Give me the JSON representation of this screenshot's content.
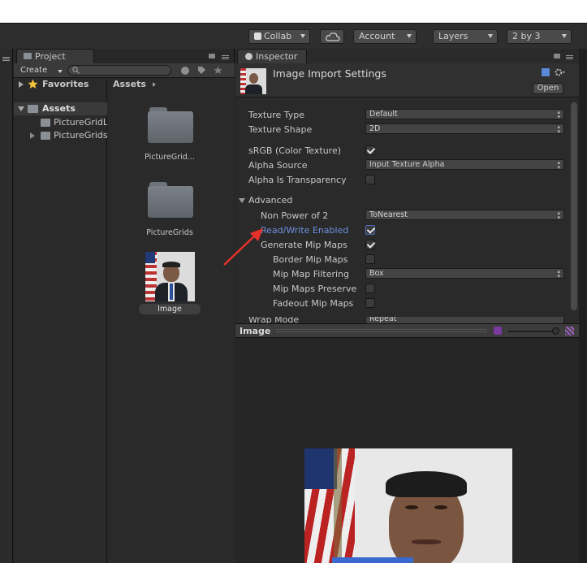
{
  "toolbar": {
    "collab": "Collab",
    "account": "Account",
    "layers": "Layers",
    "layout": "2 by 3"
  },
  "project": {
    "tab": "Project",
    "create": "Create",
    "search_placeholder": "",
    "favorites": "Favorites",
    "assets_breadcrumb": "Assets",
    "assets": "Assets",
    "tree_items": [
      "PictureGridL",
      "PictureGrids"
    ],
    "grid_items": [
      "PictureGrid...",
      "PictureGrids",
      "Image"
    ]
  },
  "inspector": {
    "tab": "Inspector",
    "title": "Image Import Settings",
    "open_button": "Open",
    "texture_type_label": "Texture Type",
    "texture_type_value": "Default",
    "texture_shape_label": "Texture Shape",
    "texture_shape_value": "2D",
    "srgb_label": "sRGB (Color Texture)",
    "srgb_checked": true,
    "alpha_source_label": "Alpha Source",
    "alpha_source_value": "Input Texture Alpha",
    "alpha_transparency_label": "Alpha Is Transparency",
    "alpha_transparency_checked": false,
    "advanced_label": "Advanced",
    "npot_label": "Non Power of 2",
    "npot_value": "ToNearest",
    "rw_label": "Read/Write Enabled",
    "rw_checked": true,
    "mipmaps_label": "Generate Mip Maps",
    "mipmaps_checked": true,
    "border_mip_label": "Border Mip Maps",
    "mip_filter_label": "Mip Map Filtering",
    "mip_filter_value": "Box",
    "mip_preserve_label": "Mip Maps Preserve",
    "fadeout_label": "Fadeout Mip Maps",
    "wrap_label": "Wrap Mode",
    "wrap_value": "Repeat"
  },
  "preview": {
    "title": "Image"
  },
  "colors": {
    "highlight_label": "#6f8fe0",
    "annotation_arrow": "#e8302a",
    "panel_bg": "#2a2a2a"
  }
}
